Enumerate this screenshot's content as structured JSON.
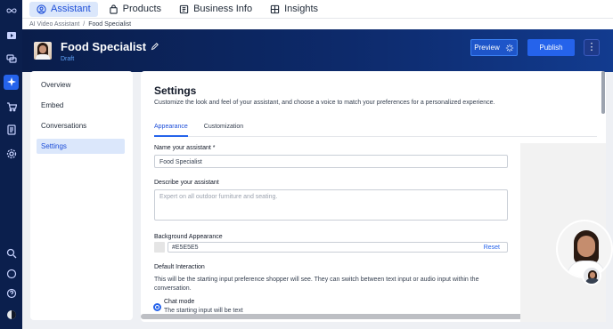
{
  "top_tabs": [
    {
      "label": "Assistant",
      "icon": "assistant-icon",
      "active": true
    },
    {
      "label": "Products",
      "icon": "bag-icon",
      "active": false
    },
    {
      "label": "Business Info",
      "icon": "book-icon",
      "active": false
    },
    {
      "label": "Insights",
      "icon": "chart-icon",
      "active": false
    }
  ],
  "breadcrumb": {
    "root": "AI Video Assistant",
    "sep": "/",
    "current": "Food Specialist"
  },
  "header": {
    "title": "Food Specialist",
    "status": "Draft",
    "preview_label": "Preview",
    "publish_label": "Publish",
    "more_label": "⋮"
  },
  "subnav": [
    "Overview",
    "Embed",
    "Conversations",
    "Settings"
  ],
  "settings": {
    "title": "Settings",
    "description": "Customize the look and feel of your assistant, and choose a voice to match your preferences for a personalized experience.",
    "tabs": [
      "Appearance",
      "Customization"
    ],
    "name_label": "Name your assistant *",
    "name_value": "Food Specialist",
    "describe_label": "Describe your assistant",
    "describe_placeholder": "Expert on all outdoor furniture and seating.",
    "bg_label": "Background Appearance",
    "bg_value": "#E5E5E5",
    "reset_label": "Reset",
    "interaction_label": "Default Interaction",
    "interaction_help": "This will be the starting input preference shopper will see. They can switch between text input or audio input within the conversation.",
    "chat_mode_title": "Chat mode",
    "chat_mode_sub": "The starting input will be text"
  },
  "colors": {
    "rail": "#0b1f4d",
    "accent": "#2563eb",
    "banner": "#0d2a6b"
  }
}
